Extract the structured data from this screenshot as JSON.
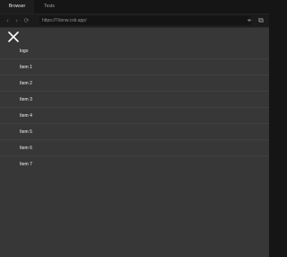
{
  "tabs": [
    {
      "label": "Browser"
    },
    {
      "label": "Tests"
    }
  ],
  "address_bar": {
    "url": "https://7dsnw.csb.app/",
    "back_icon": "chevron-left-icon",
    "forward_icon": "chevron-right-icon",
    "refresh_icon": "refresh-icon",
    "locate_icon": "crosshair-icon",
    "popout_icon": "open-in-new-window-icon"
  },
  "page": {
    "close_icon": "close-icon",
    "menu_items": [
      {
        "label": "logo"
      },
      {
        "label": "Item 1"
      },
      {
        "label": "Item 2"
      },
      {
        "label": "Item 3"
      },
      {
        "label": "Item 4"
      },
      {
        "label": "Item 5"
      },
      {
        "label": "Item 6"
      },
      {
        "label": "Item 7"
      }
    ]
  },
  "colors": {
    "chrome_bg": "#151515",
    "page_bg": "#373737",
    "text_light": "#f2f2f2"
  }
}
